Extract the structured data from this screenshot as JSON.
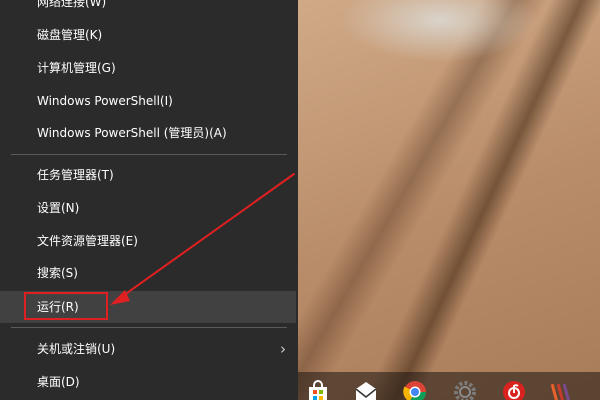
{
  "menu": {
    "items": [
      {
        "label": "网络连接(W)"
      },
      {
        "label": "磁盘管理(K)"
      },
      {
        "label": "计算机管理(G)"
      },
      {
        "label": "Windows PowerShell(I)"
      },
      {
        "label": "Windows PowerShell (管理员)(A)"
      },
      {
        "label": "任务管理器(T)"
      },
      {
        "label": "设置(N)"
      },
      {
        "label": "文件资源管理器(E)"
      },
      {
        "label": "搜索(S)"
      },
      {
        "label": "运行(R)"
      },
      {
        "label": "关机或注销(U)"
      },
      {
        "label": "桌面(D)"
      }
    ],
    "submenu_glyph": "›"
  },
  "annotation": {
    "color": "#e02020"
  },
  "taskbar": {
    "icons": [
      "store-icon",
      "mail-icon",
      "chrome-icon",
      "settings-gear-icon",
      "netease-music-icon",
      "app-icon"
    ]
  }
}
